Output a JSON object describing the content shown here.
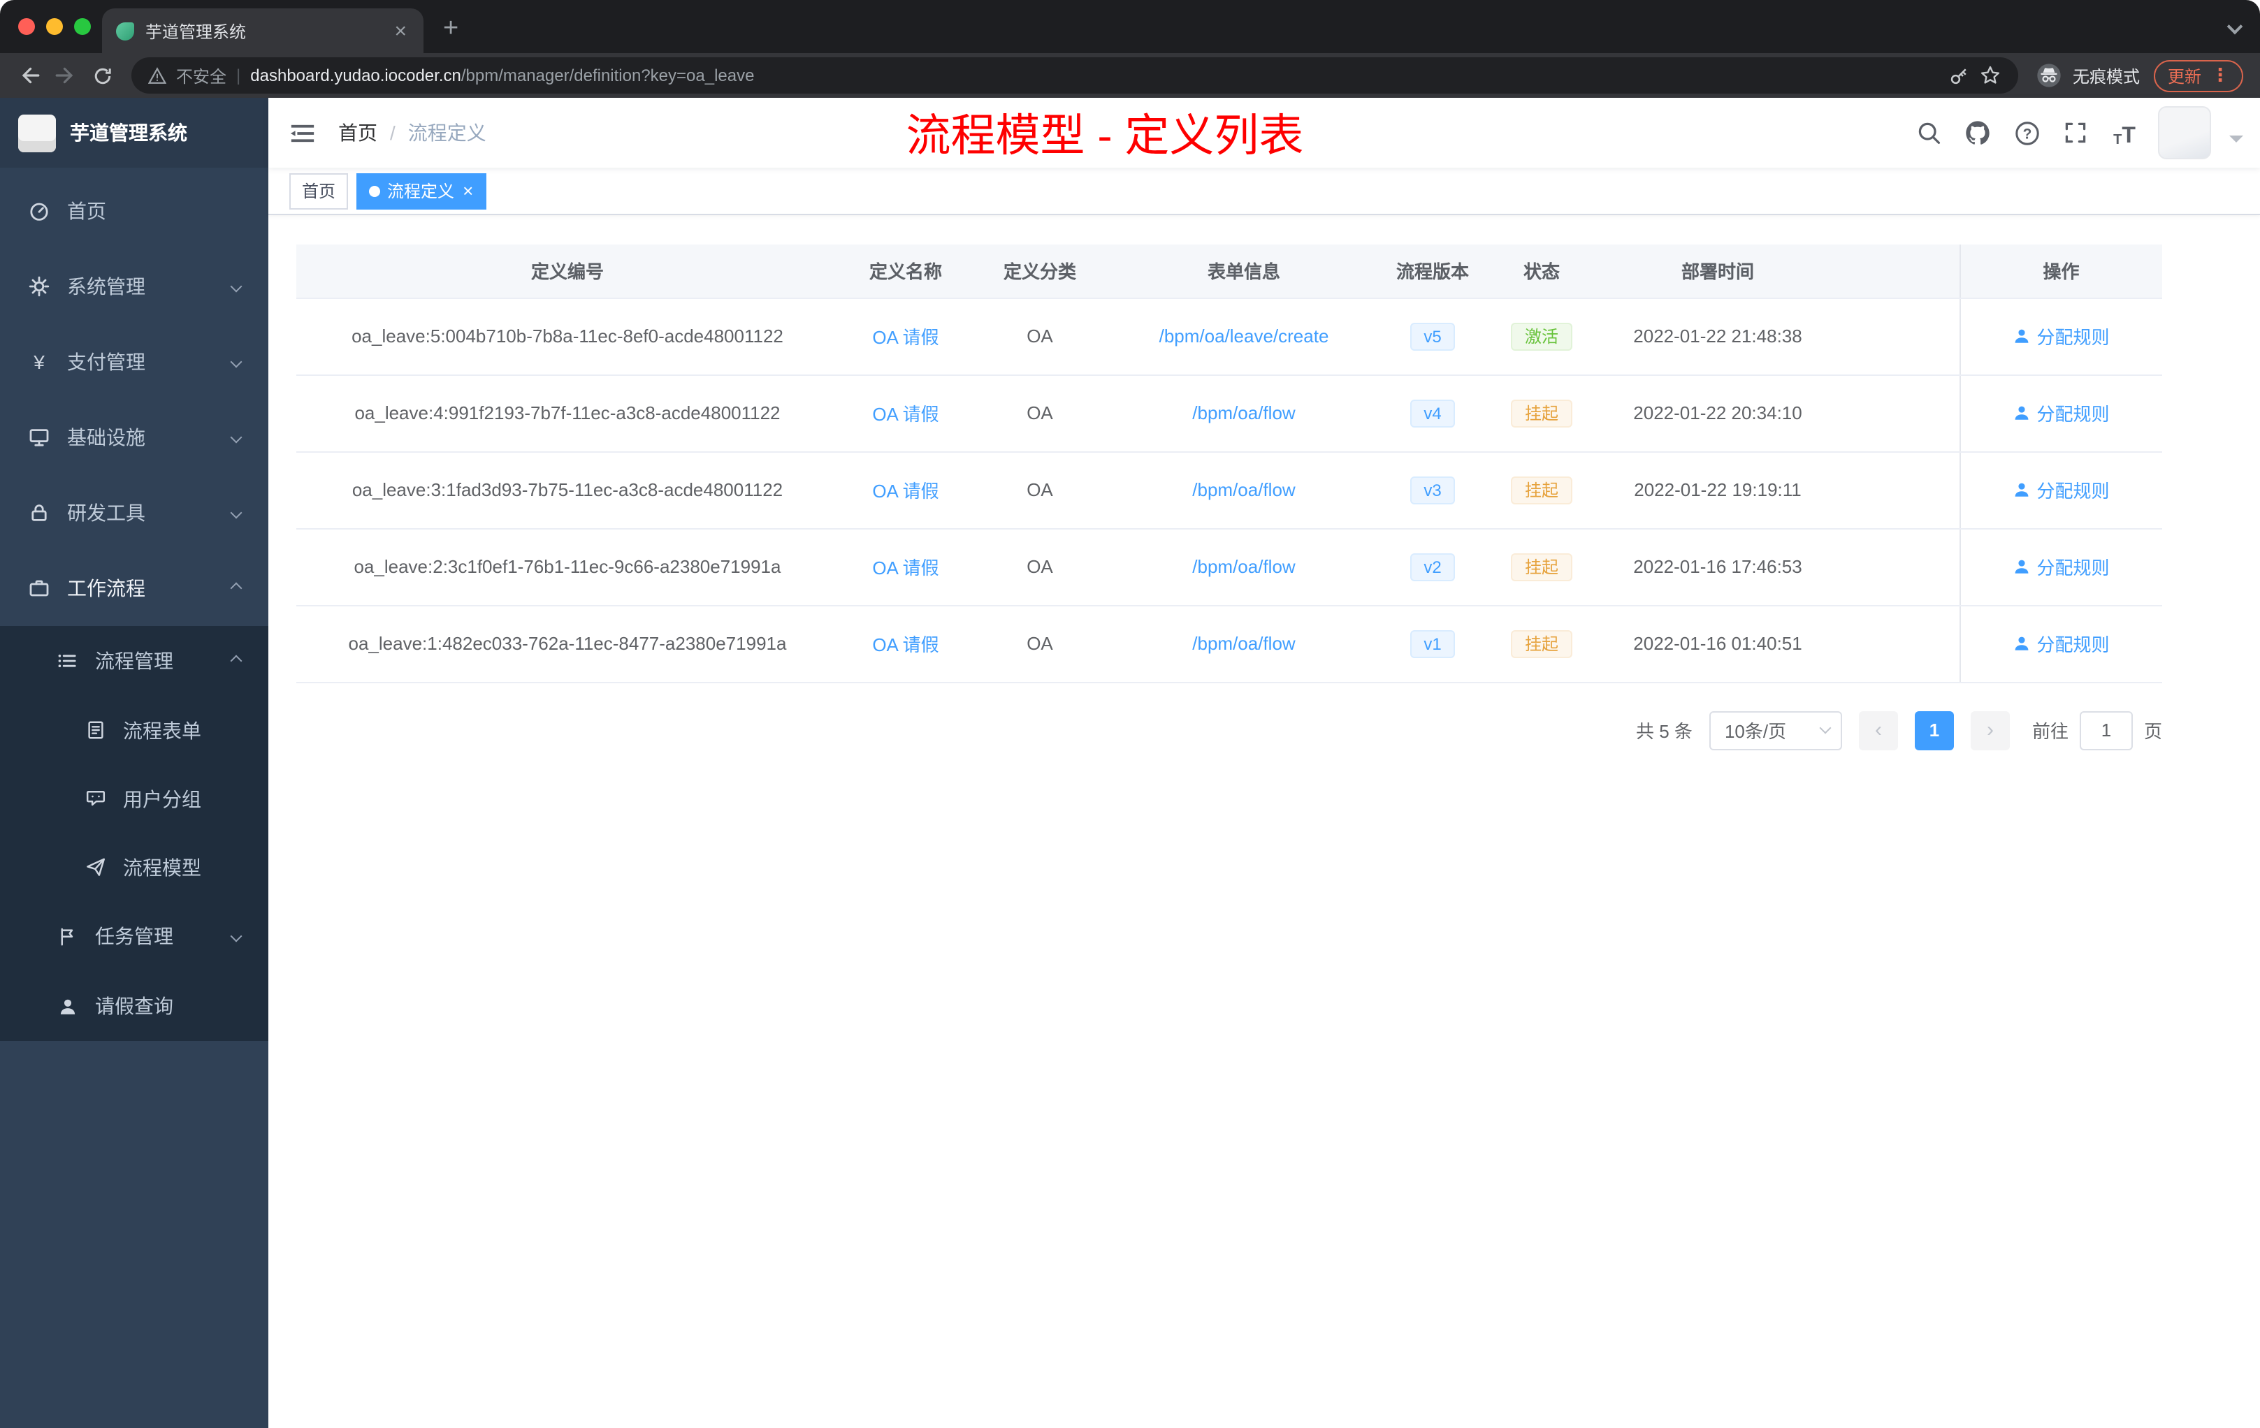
{
  "browser": {
    "tab_title": "芋道管理系统",
    "security_label": "不安全",
    "url_host": "dashboard.yudao.iocoder.cn",
    "url_path": "/bpm/manager/definition?key=oa_leave",
    "incognito_label": "无痕模式",
    "update_label": "更新"
  },
  "icons": {
    "close": "×",
    "plus": "+",
    "kebab": "⋮",
    "chevron_left": "‹",
    "chevron_right": "›",
    "question": "?",
    "yen": "¥",
    "size_small": "T",
    "size_large": "T",
    "breadcrumb_separator": "/",
    "url_separator": "|"
  },
  "sidebar": {
    "app_title": "芋道管理系统",
    "items": [
      {
        "label": "首页"
      },
      {
        "label": "系统管理"
      },
      {
        "label": "支付管理"
      },
      {
        "label": "基础设施"
      },
      {
        "label": "研发工具"
      },
      {
        "label": "工作流程"
      },
      {
        "label": "流程管理"
      },
      {
        "label": "流程表单"
      },
      {
        "label": "用户分组"
      },
      {
        "label": "流程模型"
      },
      {
        "label": "任务管理"
      },
      {
        "label": "请假查询"
      }
    ]
  },
  "header": {
    "breadcrumb": [
      "首页",
      "流程定义"
    ],
    "annotation": "流程模型 - 定义列表"
  },
  "tags": [
    {
      "label": "首页",
      "active": false
    },
    {
      "label": "流程定义",
      "active": true
    }
  ],
  "table": {
    "columns": [
      "定义编号",
      "定义名称",
      "定义分类",
      "表单信息",
      "流程版本",
      "状态",
      "部署时间",
      "操作"
    ],
    "rows": [
      {
        "id": "oa_leave:5:004b710b-7b8a-11ec-8ef0-acde48001122",
        "name": "OA 请假",
        "category": "OA",
        "form": "/bpm/oa/leave/create",
        "version": "v5",
        "status": "激活",
        "time": "2022-01-22 21:48:38",
        "action": "分配规则"
      },
      {
        "id": "oa_leave:4:991f2193-7b7f-11ec-a3c8-acde48001122",
        "name": "OA 请假",
        "category": "OA",
        "form": "/bpm/oa/flow",
        "version": "v4",
        "status": "挂起",
        "time": "2022-01-22 20:34:10",
        "action": "分配规则"
      },
      {
        "id": "oa_leave:3:1fad3d93-7b75-11ec-a3c8-acde48001122",
        "name": "OA 请假",
        "category": "OA",
        "form": "/bpm/oa/flow",
        "version": "v3",
        "status": "挂起",
        "time": "2022-01-22 19:19:11",
        "action": "分配规则"
      },
      {
        "id": "oa_leave:2:3c1f0ef1-76b1-11ec-9c66-a2380e71991a",
        "name": "OA 请假",
        "category": "OA",
        "form": "/bpm/oa/flow",
        "version": "v2",
        "status": "挂起",
        "time": "2022-01-16 17:46:53",
        "action": "分配规则"
      },
      {
        "id": "oa_leave:1:482ec033-762a-11ec-8477-a2380e71991a",
        "name": "OA 请假",
        "category": "OA",
        "form": "/bpm/oa/flow",
        "version": "v1",
        "status": "挂起",
        "time": "2022-01-16 01:40:51",
        "action": "分配规则"
      }
    ]
  },
  "pagination": {
    "total": "共 5 条",
    "page_size": "10条/页",
    "current_page": "1",
    "goto_label": "前往",
    "goto_value": "1",
    "goto_unit": "页"
  },
  "colors": {
    "accent": "#409eff",
    "status_active": "#67c23a",
    "status_suspend": "#e6a23c",
    "annotation_red": "#fe0000",
    "sidebar_bg": "#304156",
    "submenu_bg": "#1f2d3d"
  }
}
